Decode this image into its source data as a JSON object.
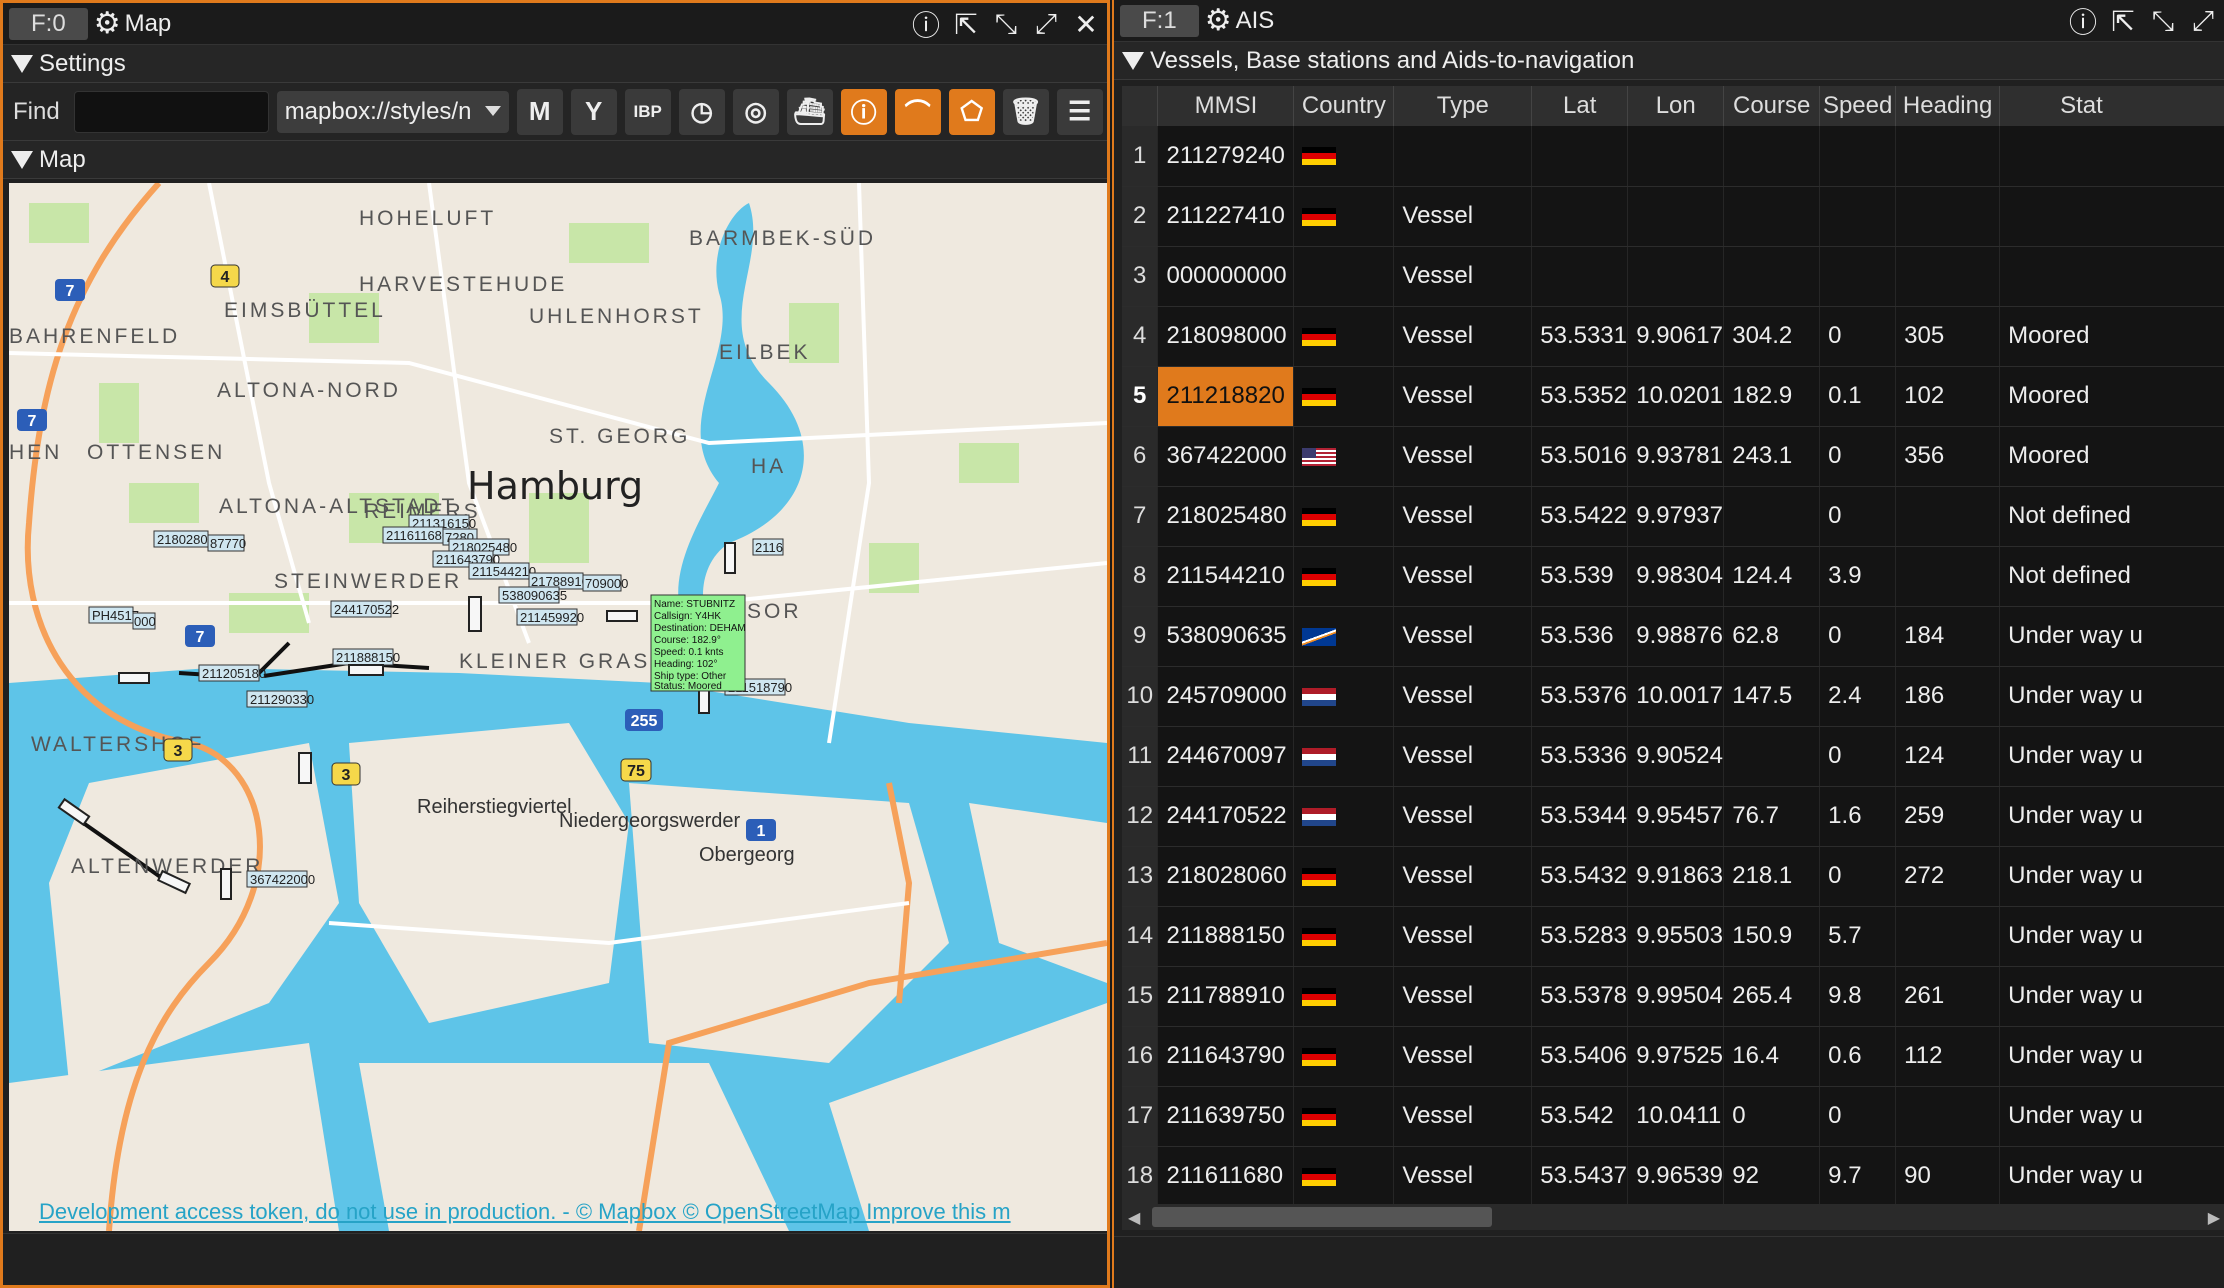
{
  "left_window": {
    "frame_tab": "F:0",
    "title": "Map",
    "settings_label": "Settings",
    "find_label": "Find",
    "find_value": "",
    "style_select": "mapbox://styles/n",
    "toolbar_buttons": [
      "M",
      "Y",
      "IBP",
      "clock",
      "radar",
      "ship",
      "info",
      "curve",
      "polygon",
      "trash",
      "menu"
    ],
    "map_section_label": "Map"
  },
  "map": {
    "city": "Hamburg",
    "districts": [
      "HOHELUFT",
      "HARVESTEHUDE",
      "EIMSBÜTTEL",
      "BAHRENFELD",
      "UHLENHORST",
      "BARMBEK-SÜD",
      "EILBEK",
      "ALTONA-NORD",
      "OTTENSEN",
      "HEN",
      "ST. GEORG",
      "ALTONA-ALTSTADT",
      "REIMERS",
      "STEINWERDER",
      "KLEINER GRASBROOK",
      "WALTERSHOF",
      "Reiherstiegviertel",
      "Niedergeorgswerder",
      "Obergeorg",
      "ALTENWERDER",
      "HA",
      "SOR"
    ],
    "road_shields": [
      "7",
      "7",
      "7",
      "4",
      "3",
      "3",
      "255",
      "75",
      "1"
    ],
    "vessel_labels": [
      "218028060",
      "87770",
      "211316150",
      "211611680",
      "7280",
      "218025480",
      "211643790",
      "211544210",
      "217889100",
      "709000",
      "538090635",
      "211459920",
      "244170522",
      "211888150",
      "211205180",
      "211290330",
      "PH4517",
      "000",
      "367422000",
      "211518790",
      "2116"
    ],
    "popup_lines": [
      "Name: STUBNITZ",
      "Callsign: Y4HK",
      "Destination: DEHAM",
      "Course: 182.9°",
      "Speed: 0.1 knts",
      "Heading: 102°",
      "Ship type: Other",
      "Status: Moored"
    ],
    "attribution": "Development access token, do not use in production. - © Mapbox © OpenStreetMap Improve this m"
  },
  "right_window": {
    "frame_tab": "F:1",
    "title": "AIS",
    "section_label": "Vessels, Base stations and Aids-to-navigation",
    "columns": [
      "MMSI",
      "Country",
      "Type",
      "Lat",
      "Lon",
      "Course",
      "Speed",
      "Heading",
      "Stat"
    ],
    "selected_row": 5,
    "rows": [
      {
        "idx": "1",
        "mmsi": "211279240",
        "flag": "de",
        "type": "",
        "lat": "",
        "lon": "",
        "course": "",
        "speed": "",
        "heading": "",
        "status": ""
      },
      {
        "idx": "2",
        "mmsi": "211227410",
        "flag": "de",
        "type": "Vessel",
        "lat": "",
        "lon": "",
        "course": "",
        "speed": "",
        "heading": "",
        "status": ""
      },
      {
        "idx": "3",
        "mmsi": "000000000",
        "flag": "",
        "type": "Vessel",
        "lat": "",
        "lon": "",
        "course": "",
        "speed": "",
        "heading": "",
        "status": ""
      },
      {
        "idx": "4",
        "mmsi": "218098000",
        "flag": "de",
        "type": "Vessel",
        "lat": "53.5331",
        "lon": "9.90617",
        "course": "304.2",
        "speed": "0",
        "heading": "305",
        "status": "Moored"
      },
      {
        "idx": "5",
        "mmsi": "211218820",
        "flag": "de",
        "type": "Vessel",
        "lat": "53.5352",
        "lon": "10.0201",
        "course": "182.9",
        "speed": "0.1",
        "heading": "102",
        "status": "Moored"
      },
      {
        "idx": "6",
        "mmsi": "367422000",
        "flag": "us",
        "type": "Vessel",
        "lat": "53.5016",
        "lon": "9.93781",
        "course": "243.1",
        "speed": "0",
        "heading": "356",
        "status": "Moored"
      },
      {
        "idx": "7",
        "mmsi": "218025480",
        "flag": "de",
        "type": "Vessel",
        "lat": "53.5422",
        "lon": "9.97937",
        "course": "",
        "speed": "0",
        "heading": "",
        "status": "Not defined"
      },
      {
        "idx": "8",
        "mmsi": "211544210",
        "flag": "de",
        "type": "Vessel",
        "lat": "53.539",
        "lon": "9.98304",
        "course": "124.4",
        "speed": "3.9",
        "heading": "",
        "status": "Not defined"
      },
      {
        "idx": "9",
        "mmsi": "538090635",
        "flag": "mh",
        "type": "Vessel",
        "lat": "53.536",
        "lon": "9.98876",
        "course": "62.8",
        "speed": "0",
        "heading": "184",
        "status": "Under way u"
      },
      {
        "idx": "10",
        "mmsi": "245709000",
        "flag": "nl",
        "type": "Vessel",
        "lat": "53.5376",
        "lon": "10.0017",
        "course": "147.5",
        "speed": "2.4",
        "heading": "186",
        "status": "Under way u"
      },
      {
        "idx": "11",
        "mmsi": "244670097",
        "flag": "nl",
        "type": "Vessel",
        "lat": "53.5336",
        "lon": "9.90524",
        "course": "",
        "speed": "0",
        "heading": "124",
        "status": "Under way u"
      },
      {
        "idx": "12",
        "mmsi": "244170522",
        "flag": "nl",
        "type": "Vessel",
        "lat": "53.5344",
        "lon": "9.95457",
        "course": "76.7",
        "speed": "1.6",
        "heading": "259",
        "status": "Under way u"
      },
      {
        "idx": "13",
        "mmsi": "218028060",
        "flag": "de",
        "type": "Vessel",
        "lat": "53.5432",
        "lon": "9.91863",
        "course": "218.1",
        "speed": "0",
        "heading": "272",
        "status": "Under way u"
      },
      {
        "idx": "14",
        "mmsi": "211888150",
        "flag": "de",
        "type": "Vessel",
        "lat": "53.5283",
        "lon": "9.95503",
        "course": "150.9",
        "speed": "5.7",
        "heading": "",
        "status": "Under way u"
      },
      {
        "idx": "15",
        "mmsi": "211788910",
        "flag": "de",
        "type": "Vessel",
        "lat": "53.5378",
        "lon": "9.99504",
        "course": "265.4",
        "speed": "9.8",
        "heading": "261",
        "status": "Under way u"
      },
      {
        "idx": "16",
        "mmsi": "211643790",
        "flag": "de",
        "type": "Vessel",
        "lat": "53.5406",
        "lon": "9.97525",
        "course": "16.4",
        "speed": "0.6",
        "heading": "112",
        "status": "Under way u"
      },
      {
        "idx": "17",
        "mmsi": "211639750",
        "flag": "de",
        "type": "Vessel",
        "lat": "53.542",
        "lon": "10.0411",
        "course": "0",
        "speed": "0",
        "heading": "",
        "status": "Under way u"
      },
      {
        "idx": "18",
        "mmsi": "211611680",
        "flag": "de",
        "type": "Vessel",
        "lat": "53.5437",
        "lon": "9.96539",
        "course": "92",
        "speed": "9.7",
        "heading": "90",
        "status": "Under way u"
      }
    ]
  },
  "colors": {
    "accent": "#e07a1c",
    "water": "#5ec4e8",
    "land": "#efe9df",
    "park": "#c8e6a8",
    "popup": "#8ff08f"
  }
}
